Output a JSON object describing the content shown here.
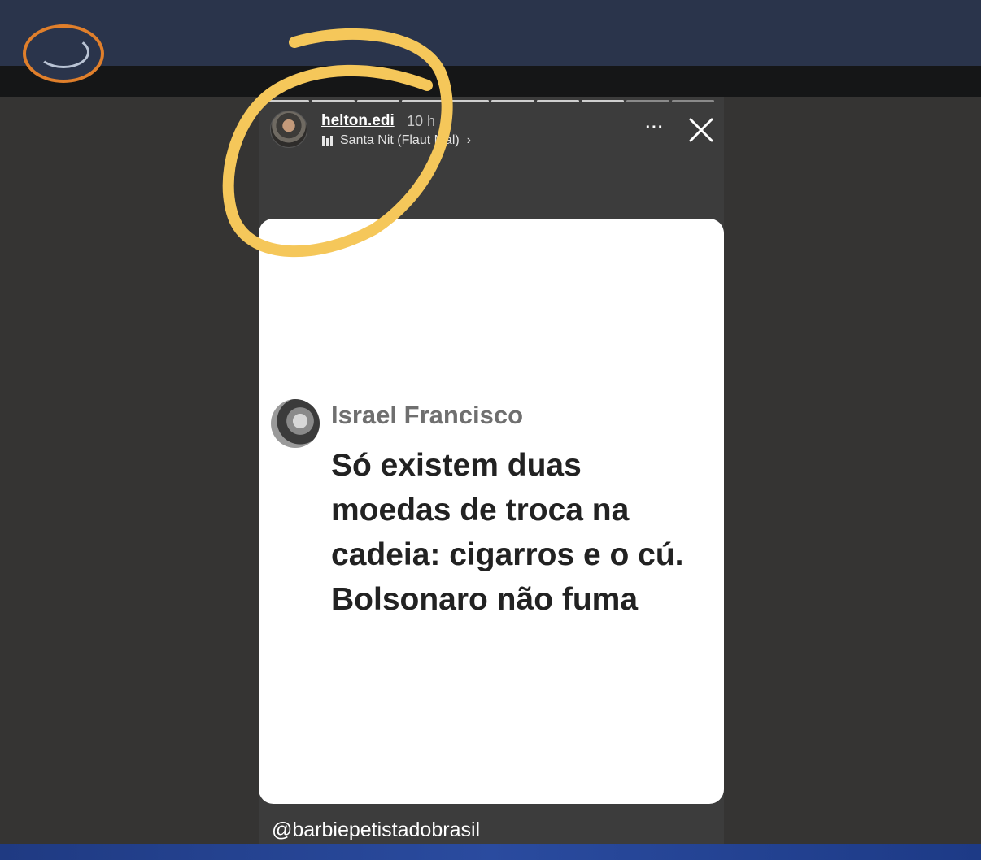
{
  "story": {
    "username": "helton.edi",
    "time": "10 h",
    "music": "Santa Nit (Flaut Mal)",
    "music_chevron": "›",
    "more_icon": "more-horizontal-icon",
    "close_icon": "close-icon",
    "progress_segments": 10,
    "progress_done": 8
  },
  "post": {
    "author": "Israel Francisco",
    "lines": [
      "Só existem duas",
      "moedas de troca na",
      "cadeia: cigarros e o cú.",
      "Bolsonaro não fuma"
    ]
  },
  "caption": "@barbiepetistadobrasil",
  "colors": {
    "top_bar": "#2a344b",
    "background": "#353433",
    "highlight": "#f5c75a",
    "bottom_bar": "#2a4b9f"
  }
}
